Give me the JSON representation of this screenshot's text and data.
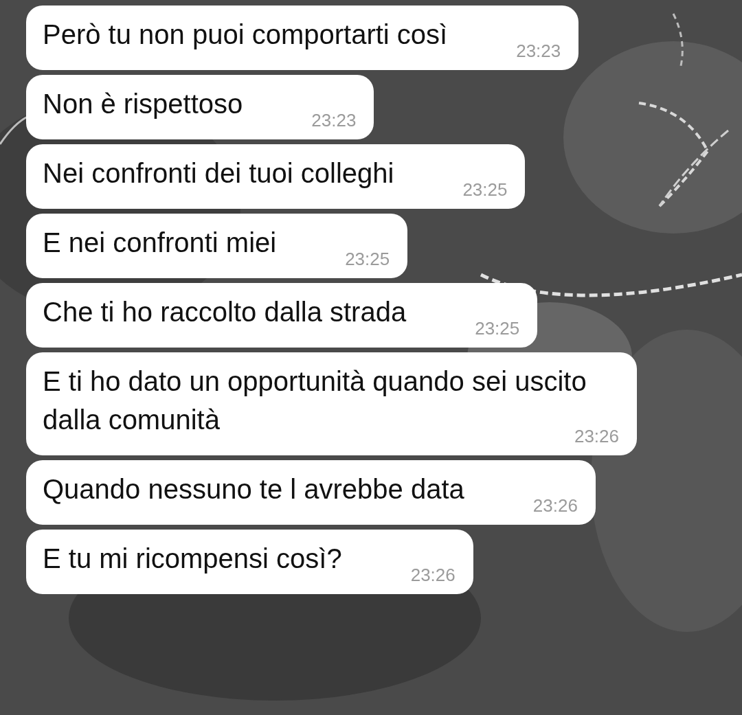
{
  "messages": [
    {
      "text": "Però tu non puoi comportarti così",
      "time": "23:23"
    },
    {
      "text": "Non è rispettoso",
      "time": "23:23"
    },
    {
      "text": "Nei confronti dei tuoi colleghi",
      "time": "23:25"
    },
    {
      "text": "E nei confronti miei",
      "time": "23:25"
    },
    {
      "text": "Che ti ho raccolto dalla strada",
      "time": "23:25"
    },
    {
      "text": "E ti ho dato un opportunità quando sei uscito dalla comunità",
      "time": "23:26"
    },
    {
      "text": "Quando nessuno te l avrebbe data",
      "time": "23:26"
    },
    {
      "text": "E tu mi ricompensi così?",
      "time": "23:26"
    }
  ]
}
